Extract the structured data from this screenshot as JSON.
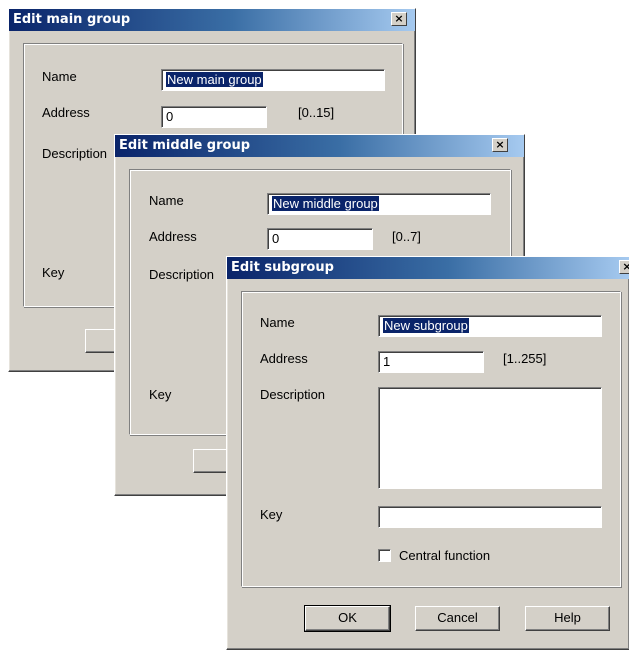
{
  "dialogs": {
    "main_group": {
      "title": "Edit main group",
      "close_glyph": "×",
      "labels": {
        "name": "Name",
        "address": "Address",
        "description": "Description",
        "key": "Key"
      },
      "name_value": "New main group",
      "address_value": "0",
      "address_range": "[0..15]"
    },
    "middle_group": {
      "title": "Edit middle group",
      "close_glyph": "×",
      "labels": {
        "name": "Name",
        "address": "Address",
        "description": "Description",
        "key": "Key"
      },
      "name_value": "New middle group",
      "address_value": "0",
      "address_range": "[0..7]"
    },
    "subgroup": {
      "title": "Edit subgroup",
      "close_glyph": "×",
      "labels": {
        "name": "Name",
        "address": "Address",
        "description": "Description",
        "key": "Key"
      },
      "name_value": "New subgroup",
      "address_value": "1",
      "address_range": "[1..255]",
      "description_value": "",
      "key_value": "",
      "central_function_label": "Central function",
      "central_function_checked": false,
      "buttons": {
        "ok": "OK",
        "cancel": "Cancel",
        "help": "Help"
      }
    }
  },
  "colors": {
    "title_gradient_start": "#0a246a",
    "title_gradient_end": "#a6caf0",
    "dialog_face": "#d4d0c8",
    "selection": "#0a246a"
  },
  "icons": {
    "close": "close-icon"
  }
}
